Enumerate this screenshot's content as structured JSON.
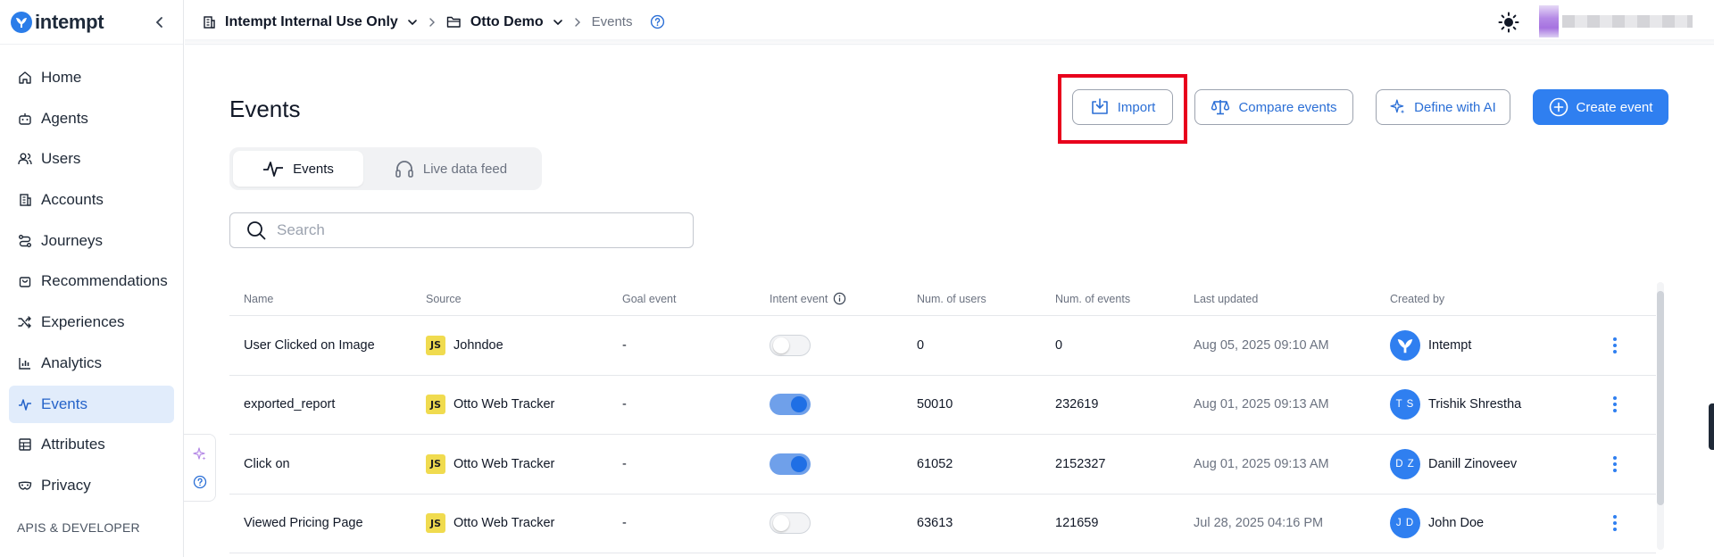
{
  "brand": {
    "name": "intempt"
  },
  "sidebar": {
    "items": [
      {
        "label": "Home",
        "icon": "home-icon"
      },
      {
        "label": "Agents",
        "icon": "robot-icon"
      },
      {
        "label": "Users",
        "icon": "users-icon"
      },
      {
        "label": "Accounts",
        "icon": "building-icon"
      },
      {
        "label": "Journeys",
        "icon": "route-icon"
      },
      {
        "label": "Recommendations",
        "icon": "bag-icon"
      },
      {
        "label": "Experiences",
        "icon": "shuffle-icon"
      },
      {
        "label": "Analytics",
        "icon": "bar-chart-icon"
      },
      {
        "label": "Events",
        "icon": "activity-icon",
        "active": true
      },
      {
        "label": "Attributes",
        "icon": "table-icon"
      },
      {
        "label": "Privacy",
        "icon": "mask-icon"
      }
    ],
    "section_label": "APIS & DEVELOPER"
  },
  "breadcrumb": {
    "workspace": "Intempt Internal Use Only",
    "project": "Otto Demo",
    "page": "Events"
  },
  "page": {
    "title": "Events"
  },
  "actions": {
    "import": "Import",
    "compare": "Compare events",
    "define_ai": "Define with AI",
    "create": "Create event"
  },
  "tabs": {
    "events": "Events",
    "live": "Live data feed"
  },
  "search": {
    "placeholder": "Search",
    "value": ""
  },
  "table": {
    "headers": {
      "name": "Name",
      "source": "Source",
      "goal": "Goal event",
      "intent": "Intent event",
      "users": "Num. of users",
      "events": "Num. of events",
      "updated": "Last updated",
      "created": "Created by"
    },
    "rows": [
      {
        "name": "User Clicked on Image",
        "source": "Johndoe",
        "goal": "-",
        "intent": false,
        "users": "0",
        "events": "0",
        "updated": "Aug 05, 2025 09:10 AM",
        "creator": "Intempt",
        "initials": ""
      },
      {
        "name": "exported_report",
        "source": "Otto Web Tracker",
        "goal": "-",
        "intent": true,
        "users": "50010",
        "events": "232619",
        "updated": "Aug 01, 2025 09:13 AM",
        "creator": "Trishik Shrestha",
        "initials": "TS"
      },
      {
        "name": "Click on",
        "source": "Otto Web Tracker",
        "goal": "-",
        "intent": true,
        "users": "61052",
        "events": "2152327",
        "updated": "Aug 01, 2025 09:13 AM",
        "creator": "Danill Zinoveev",
        "initials": "DZ"
      },
      {
        "name": "Viewed Pricing Page",
        "source": "Otto Web Tracker",
        "goal": "-",
        "intent": false,
        "users": "63613",
        "events": "121659",
        "updated": "Jul 28, 2025 04:16 PM",
        "creator": "John Doe",
        "initials": "JD"
      }
    ],
    "source_badge": "JS"
  },
  "colors": {
    "accent": "#2f7ff0",
    "highlight": "#e8001c",
    "active_nav_bg": "#e1ecfb"
  }
}
